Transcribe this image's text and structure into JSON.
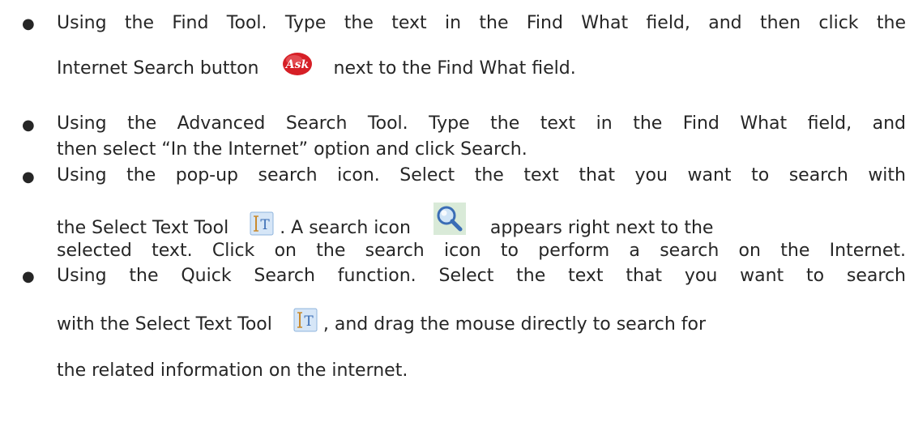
{
  "bullets": [
    {
      "line1": "Using the Find Tool. Type the text in the Find What field, and then click the",
      "line2_before": "Internet Search button",
      "line2_after": "next to the Find What field.",
      "ask_icon_text": "Ask"
    },
    {
      "line1": "Using the Advanced Search Tool. Type the text in the Find What field, and",
      "line2": "then select “In the Internet” option and click Search."
    },
    {
      "line1": "Using the pop-up search icon. Select the text that you want to search with",
      "line2_a": "the Select Text Tool",
      "line2_b": ". A search icon",
      "line2_c": "appears right next to the",
      "line3": "selected text. Click on the search icon to perform a search on the Internet.",
      "select_tool_icon_text": "IT"
    },
    {
      "line1": "Using the Quick Search function. Select the text that you want to search",
      "line2_a": "with the Select Text Tool",
      "line2_b": ", and drag the mouse directly to search for",
      "line3": "the related information on the internet.",
      "select_tool_icon_text": "IT"
    }
  ],
  "bullet_symbol": "●",
  "colors": {
    "text": "#262626",
    "ask_red": "#d61f26",
    "icon_blue": "#4a7fc1",
    "icon_bg": "#d6e6f7",
    "magnifier_bg": "#d9ead8"
  }
}
